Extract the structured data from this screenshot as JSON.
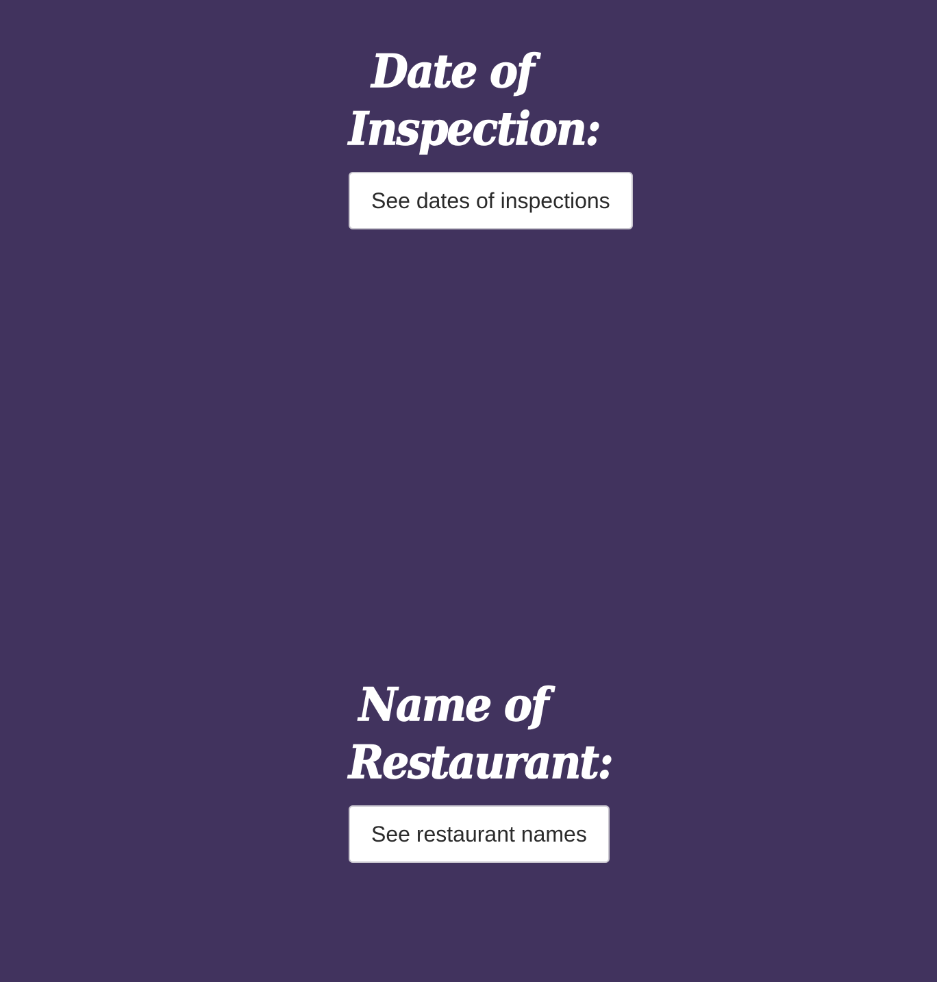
{
  "sections": {
    "date": {
      "heading_line1": "Date of",
      "heading_line2": "Inspection:",
      "button_label": "See dates of inspections"
    },
    "name": {
      "heading_line1": "Name of",
      "heading_line2": "Restaurant:",
      "button_label": "See restaurant names"
    }
  },
  "colors": {
    "background": "#41335e",
    "heading_text": "#ffffff",
    "button_background": "#ffffff",
    "button_text": "#2b2b2b",
    "button_border": "#c9c6cf"
  }
}
